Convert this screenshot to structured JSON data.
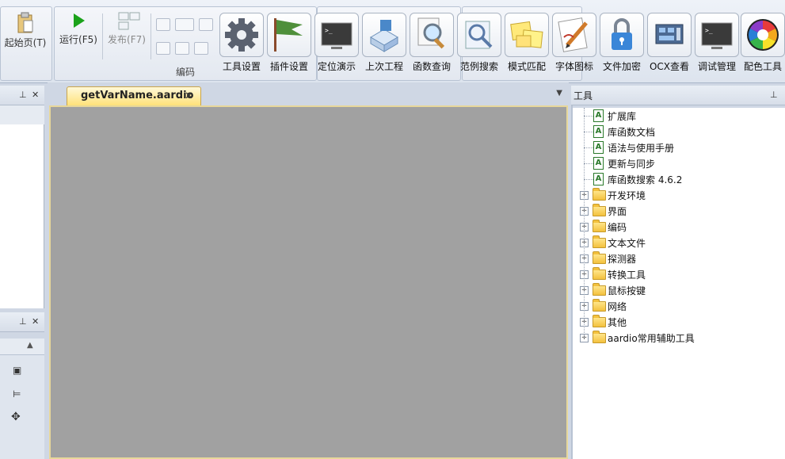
{
  "ribbon": {
    "start_page": "起始页(T)",
    "run": "运行(F5)",
    "publish": "发布(F7)",
    "group_code": "编码",
    "tools": [
      {
        "label": "工具设置",
        "icon": "gear-icon"
      },
      {
        "label": "插件设置",
        "icon": "flag-icon"
      },
      {
        "label": "定位演示",
        "icon": "terminal-icon"
      },
      {
        "label": "上次工程",
        "icon": "project-icon"
      },
      {
        "label": "函数查询",
        "icon": "magnifier-icon"
      },
      {
        "label": "范例搜索",
        "icon": "search-example-icon"
      },
      {
        "label": "模式匹配",
        "icon": "notes-icon"
      },
      {
        "label": "字体图标",
        "icon": "pencil-doc-icon"
      },
      {
        "label": "文件加密",
        "icon": "lock-icon"
      },
      {
        "label": "OCX查看",
        "icon": "component-icon"
      },
      {
        "label": "调试管理",
        "icon": "console-icon"
      },
      {
        "label": "配色工具",
        "icon": "color-wheel-icon"
      }
    ]
  },
  "editor": {
    "tab_title": "getVarName.aardio"
  },
  "tools_pane": {
    "title": "工具",
    "items": [
      {
        "label": "扩展库",
        "type": "file"
      },
      {
        "label": "库函数文档",
        "type": "file"
      },
      {
        "label": "语法与使用手册",
        "type": "file"
      },
      {
        "label": "更新与同步",
        "type": "file"
      },
      {
        "label": "库函数搜索 4.6.2",
        "type": "file"
      },
      {
        "label": "开发环境",
        "type": "folder"
      },
      {
        "label": "界面",
        "type": "folder"
      },
      {
        "label": "编码",
        "type": "folder"
      },
      {
        "label": "文本文件",
        "type": "folder"
      },
      {
        "label": "探测器",
        "type": "folder"
      },
      {
        "label": "转换工具",
        "type": "folder"
      },
      {
        "label": "鼠标按键",
        "type": "folder"
      },
      {
        "label": "网络",
        "type": "folder"
      },
      {
        "label": "其他",
        "type": "folder"
      },
      {
        "label": "aardio常用辅助工具",
        "type": "folder"
      }
    ]
  },
  "colors": {
    "editor_bg": "#a1a1a1",
    "tab_accent": "#ffe27a"
  }
}
